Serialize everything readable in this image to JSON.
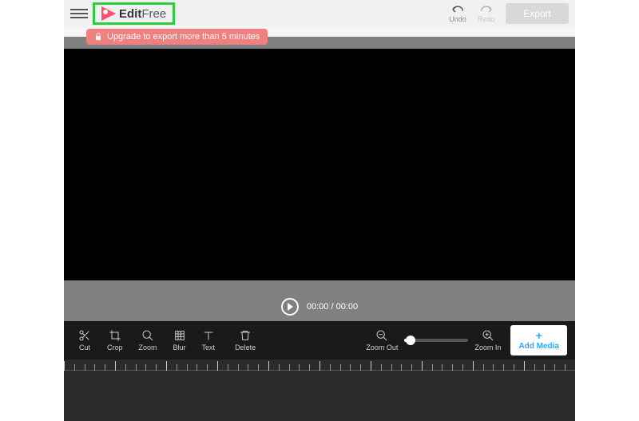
{
  "header": {
    "logo_bold": "Edit",
    "logo_light": "Free",
    "undo_label": "Undo",
    "redo_label": "Redo",
    "export_label": "Export"
  },
  "banner": {
    "text": "Upgrade to export more than 5 minutes"
  },
  "playback": {
    "time": "00:00 / 00:00"
  },
  "tools": {
    "cut": "Cut",
    "crop": "Crop",
    "zoom": "Zoom",
    "blur": "Blur",
    "text": "Text",
    "delete": "Delete",
    "zoom_out": "Zoom Out",
    "zoom_in": "Zoom In",
    "add_media": "Add Media"
  }
}
